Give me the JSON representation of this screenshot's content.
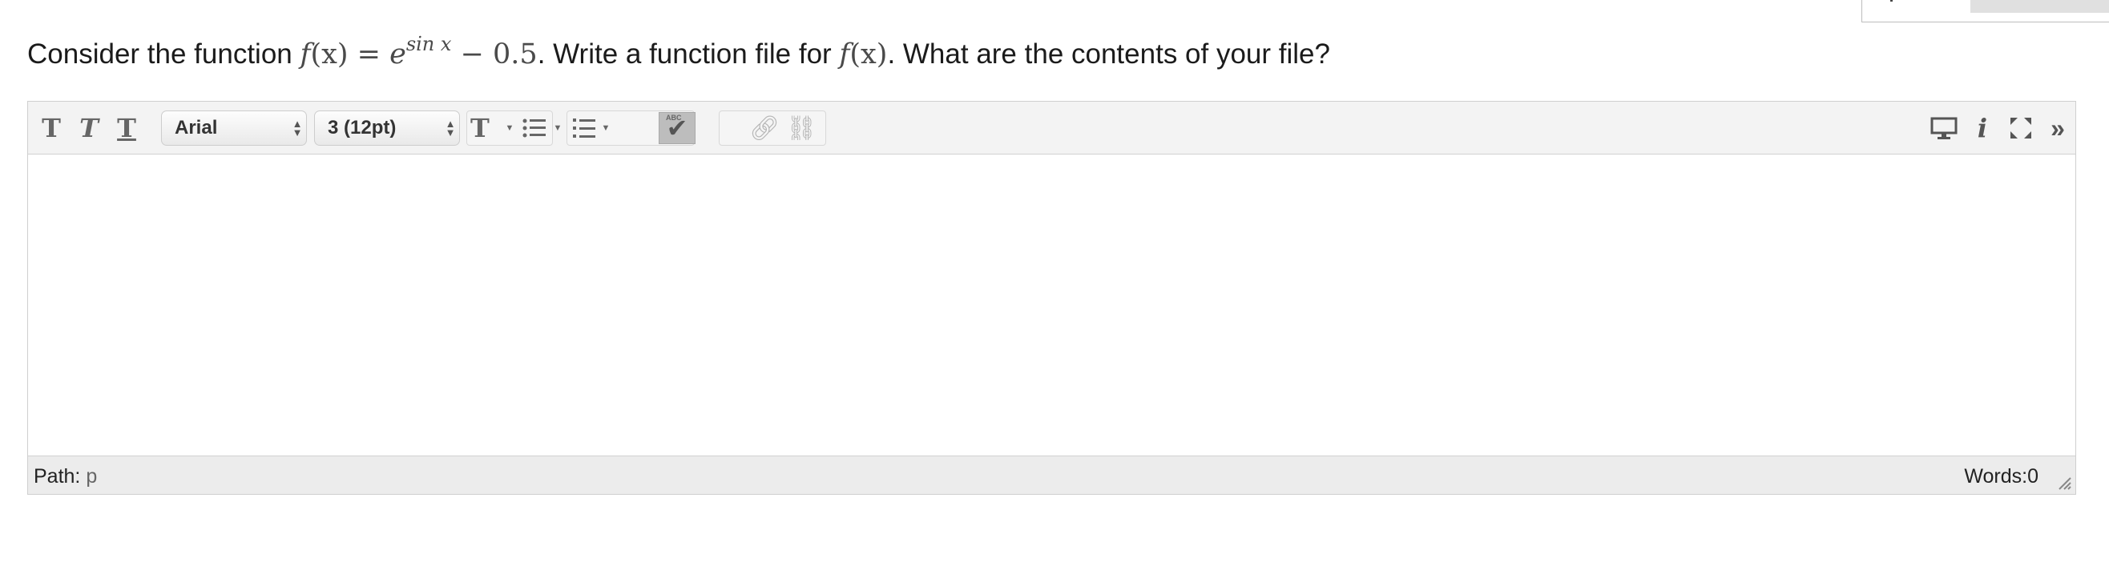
{
  "question": {
    "prefix": "Consider the function ",
    "f": "f",
    "x_arg": "(x)",
    "equals": " = ",
    "e": "e",
    "exponent": "sin x",
    "tail": " − 0.5",
    "middle": ". Write a function file for ",
    "f2": "f",
    "x_arg2": "(x)",
    "suffix": ". What are the contents of your file?"
  },
  "toolbar": {
    "bold_glyph": "T",
    "italic_glyph": "T",
    "underline_glyph": "T",
    "font_family_value": "Arial",
    "font_size_value": "3 (12pt)",
    "text_color_glyph": "T",
    "spell_abc": "ABC"
  },
  "status": {
    "path_label": "Path:",
    "path_value": "p",
    "words_label": "Words:",
    "words_count": "0"
  }
}
